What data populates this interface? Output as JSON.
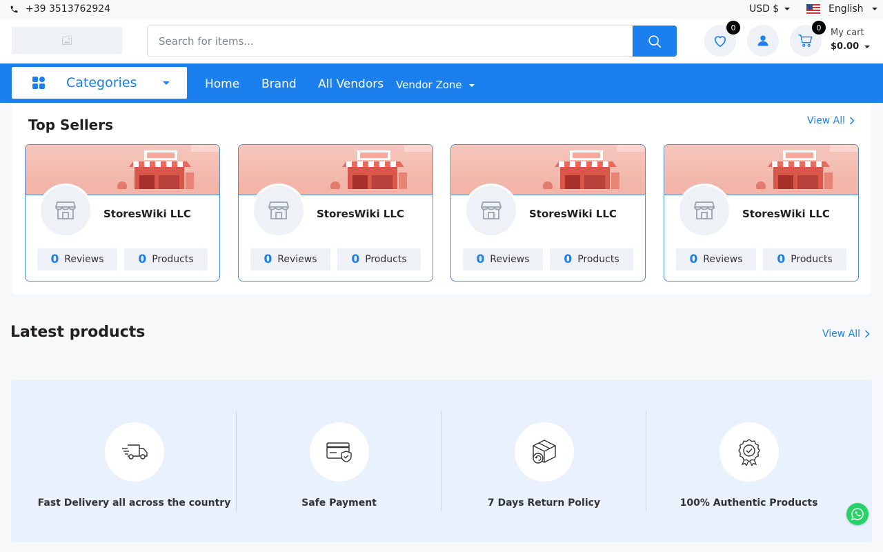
{
  "topbar": {
    "phone": "+39 3513762924",
    "currency": "USD $",
    "language": "English"
  },
  "header": {
    "search_placeholder": "Search for items...",
    "wishlist_count": "0",
    "cart_count": "0",
    "cart_label": "My cart",
    "cart_total": "$0.00"
  },
  "nav": {
    "categories": "Categories",
    "links": [
      "Home",
      "Brand",
      "All Vendors"
    ],
    "vendor_zone": "Vendor Zone"
  },
  "top_sellers": {
    "title": "Top Sellers",
    "view_all": "View All",
    "cards": [
      {
        "name": "StoresWiki LLC",
        "reviews": "0",
        "reviews_label": "Reviews",
        "products": "0",
        "products_label": "Products"
      },
      {
        "name": "StoresWiki LLC",
        "reviews": "0",
        "reviews_label": "Reviews",
        "products": "0",
        "products_label": "Products"
      },
      {
        "name": "StoresWiki LLC",
        "reviews": "0",
        "reviews_label": "Reviews",
        "products": "0",
        "products_label": "Products"
      },
      {
        "name": "StoresWiki LLC",
        "reviews": "0",
        "reviews_label": "Reviews",
        "products": "0",
        "products_label": "Products"
      }
    ]
  },
  "latest_products": {
    "title": "Latest products",
    "view_all": "View All"
  },
  "features": [
    {
      "text": "Fast Delivery all across the country",
      "icon": "delivery-truck-icon"
    },
    {
      "text": "Safe Payment",
      "icon": "secure-card-icon"
    },
    {
      "text": "7 Days Return Policy",
      "icon": "return-box-icon"
    },
    {
      "text": "100% Authentic Products",
      "icon": "authentic-badge-icon"
    }
  ],
  "colors": {
    "primary": "#1b7fed",
    "features_bg": "#e8f1fc",
    "whatsapp": "#25d366"
  }
}
